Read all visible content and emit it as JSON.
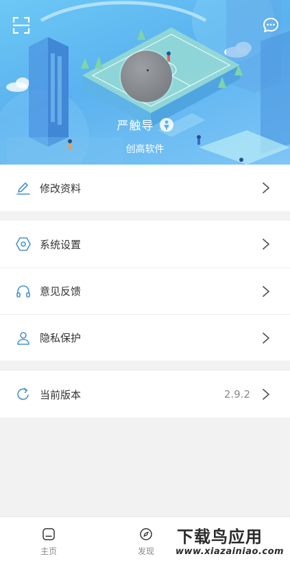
{
  "colors": {
    "accent": "#4a90c8",
    "header_bg": "#5ab2ef",
    "chevron": "#555555",
    "background": "#f2f2f2"
  },
  "header": {
    "scan_icon": "scan-icon",
    "message_icon": "message-icon",
    "user_name": "严触导",
    "gender_icon": "gender-icon",
    "company": "创高软件"
  },
  "menu": {
    "edit_profile": "修改资料",
    "system_settings": "系统设置",
    "feedback": "意见反馈",
    "privacy": "隐私保护",
    "current_version": "当前版本",
    "version_value": "2.9.2"
  },
  "tabbar": {
    "home": "主页",
    "discover": "发现"
  },
  "watermark": {
    "text": "下载鸟应用",
    "url": "www.xiazainiao.com"
  }
}
